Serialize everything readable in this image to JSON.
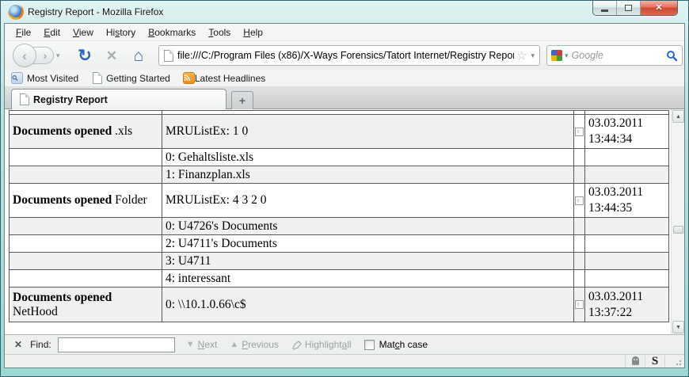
{
  "window": {
    "title": "Registry Report - Mozilla Firefox",
    "controls": {
      "close_icon": "✕"
    }
  },
  "menu": {
    "items": [
      {
        "pre": "",
        "u": "F",
        "post": "ile"
      },
      {
        "pre": "",
        "u": "E",
        "post": "dit"
      },
      {
        "pre": "",
        "u": "V",
        "post": "iew"
      },
      {
        "pre": "Hi",
        "u": "s",
        "post": "tory"
      },
      {
        "pre": "",
        "u": "B",
        "post": "ookmarks"
      },
      {
        "pre": "",
        "u": "T",
        "post": "ools"
      },
      {
        "pre": "",
        "u": "H",
        "post": "elp"
      }
    ]
  },
  "nav": {
    "back_icon": "‹",
    "forward_icon": "›",
    "dropdown_icon": "▾",
    "reload_icon": "↻",
    "stop_icon": "✕",
    "home_icon": "⌂",
    "url": "file:///C:/Program Files (x86)/X-Ways Forensics/Tatort Internet/Registry Repor",
    "star_icon": "☆",
    "url_dropdown_icon": "▾"
  },
  "search": {
    "placeholder": "Google",
    "engine_dropdown_icon": "▾"
  },
  "bookmarks": {
    "items": [
      "Most Visited",
      "Getting Started",
      "Latest Headlines"
    ]
  },
  "tabs": {
    "active": "Registry Report",
    "new_tab": "+"
  },
  "table": {
    "marker_glyph": "r",
    "rows": [
      {
        "label_bold": "Documents opened",
        "label_rest": ".xls",
        "value": "MRUListEx: 1 0",
        "date": "03.03.2011 13:44:34"
      },
      {
        "value": "0: Gehaltsliste.xls"
      },
      {
        "value": "1: Finanzplan.xls"
      },
      {
        "label_bold": "Documents opened",
        "label_rest": "Folder",
        "value": "MRUListEx: 4 3 2 0",
        "date": "03.03.2011 13:44:35"
      },
      {
        "value": "0: U4726's Documents"
      },
      {
        "value": "2: U4711's Documents"
      },
      {
        "value": "3: U4711"
      },
      {
        "value": "4: interessant"
      },
      {
        "label_bold": "Documents opened",
        "label_rest": "NetHood",
        "value": "0: \\\\10.1.0.66\\c$",
        "date": "03.03.2011 13:37:22"
      }
    ]
  },
  "scrollbar": {
    "up_icon": "▲",
    "down_icon": "▼"
  },
  "find_bar": {
    "close_icon": "✕",
    "label": "Find:",
    "next": {
      "arrow": "▼",
      "pre": "",
      "u": "N",
      "post": "ext"
    },
    "previous": {
      "arrow": "▲",
      "pre": "",
      "u": "P",
      "post": "revious"
    },
    "highlight": {
      "pre": "Highlight ",
      "u": "a",
      "post": "ll"
    },
    "match_case": {
      "pre": "Mat",
      "u": "c",
      "post": "h case"
    }
  },
  "status_bar": {
    "noscript_label": "S"
  },
  "colors": {
    "frame_teal": "#9ed8d3",
    "close_red": "#cc4834",
    "row_stripe": "#f0f0f0",
    "accent_blue": "#2d64c6",
    "rss_orange": "#ef8c16"
  }
}
